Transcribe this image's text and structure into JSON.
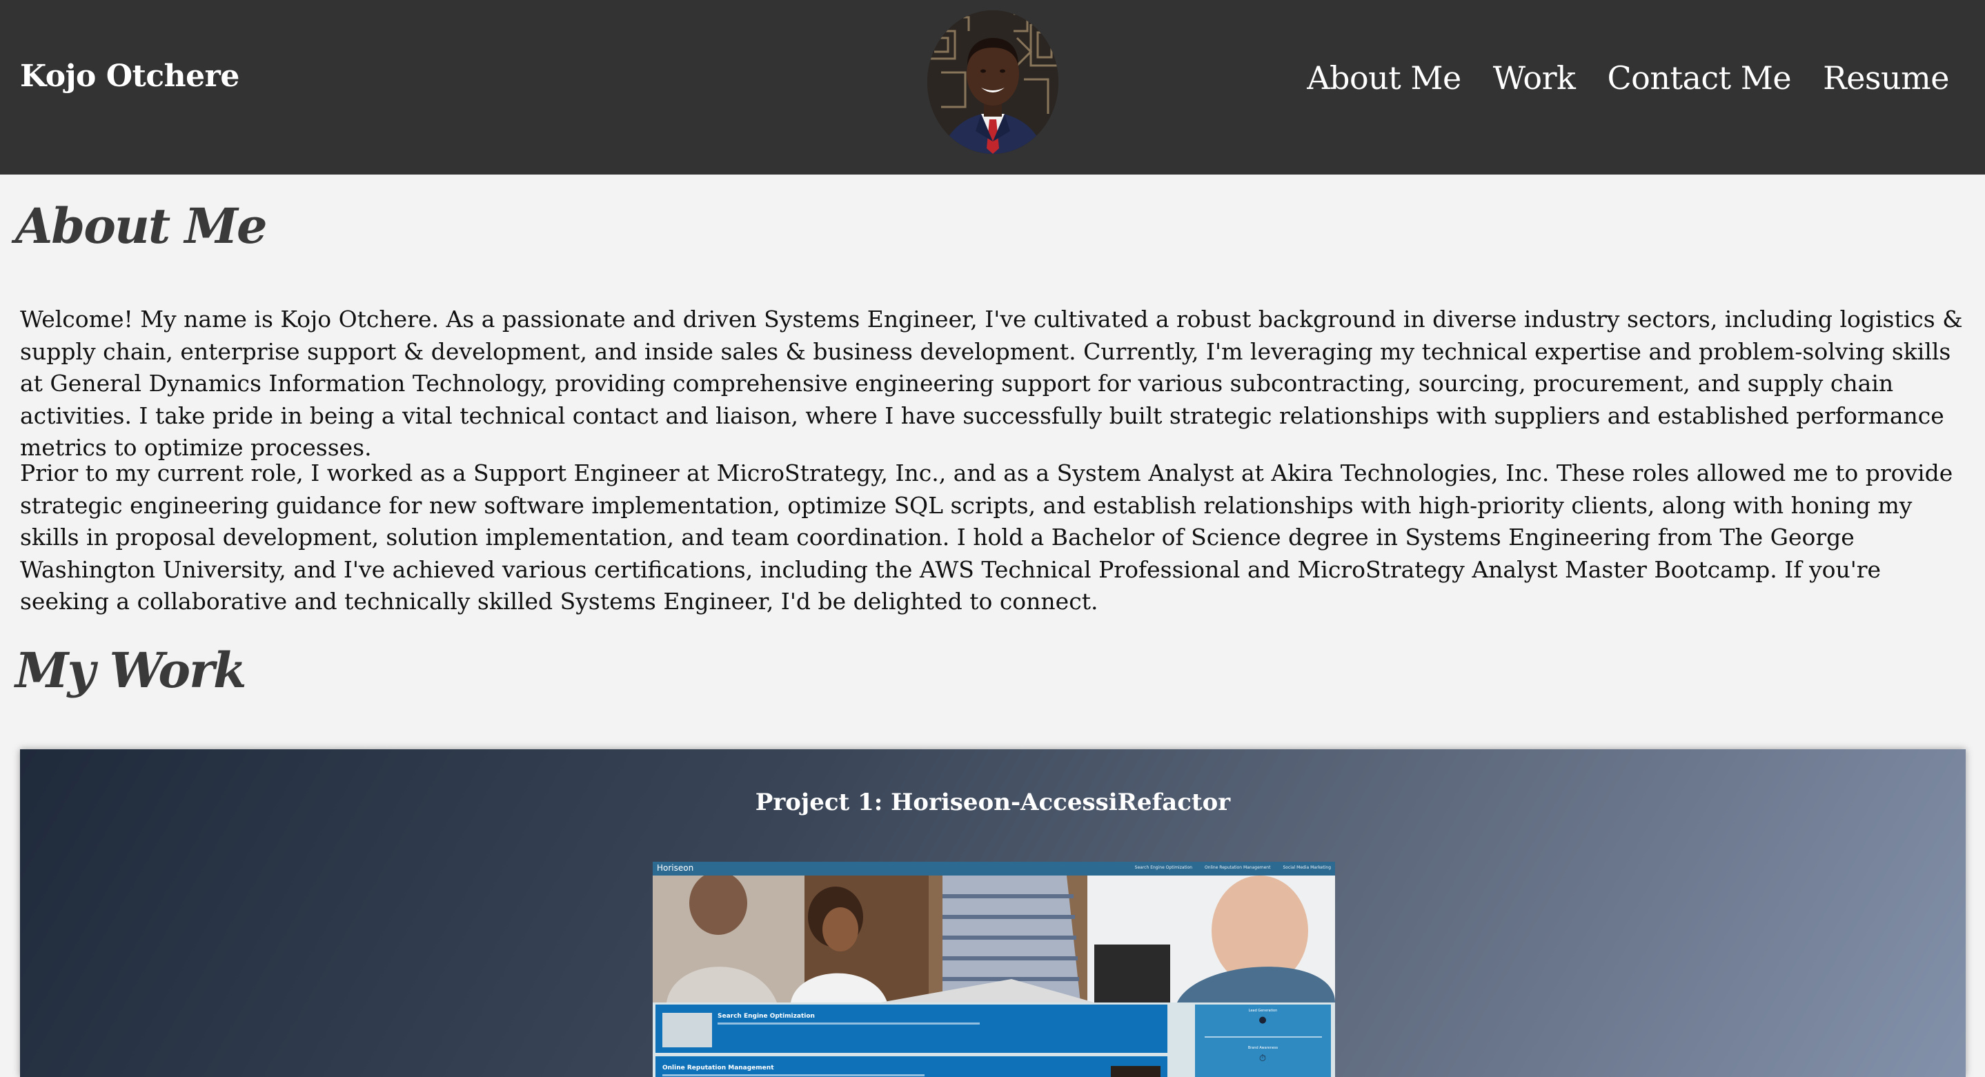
{
  "header": {
    "brand": "Kojo Otchere",
    "nav": [
      {
        "label": "About Me"
      },
      {
        "label": "Work"
      },
      {
        "label": "Contact Me"
      },
      {
        "label": "Resume"
      }
    ]
  },
  "about": {
    "heading": "About Me",
    "paragraphs": [
      "Welcome! My name is Kojo Otchere. As a passionate and driven Systems Engineer, I've cultivated a robust background in diverse industry sectors, including logistics & supply chain, enterprise support & development, and inside sales & business development. Currently, I'm leveraging my technical expertise and problem-solving skills at General Dynamics Information Technology, providing comprehensive engineering support for various subcontracting, sourcing, procurement, and supply chain activities. I take pride in being a vital technical contact and liaison, where I have successfully built strategic relationships with suppliers and established performance metrics to optimize processes.",
      "Prior to my current role, I worked as a Support Engineer at MicroStrategy, Inc., and as a System Analyst at Akira Technologies, Inc. These roles allowed me to provide strategic engineering guidance for new software implementation, optimize SQL scripts, and establish relationships with high-priority clients, along with honing my skills in proposal development, solution implementation, and team coordination. I hold a Bachelor of Science degree in Systems Engineering from The George Washington University, and I've achieved various certifications, including the AWS Technical Professional and MicroStrategy Analyst Master Bootcamp. If you're seeking a collaborative and technically skilled Systems Engineer, I'd be delighted to connect."
    ]
  },
  "work": {
    "heading": "My Work",
    "projects": [
      {
        "title": "Project 1: Horiseon-AccessiRefactor",
        "screenshot": {
          "logo": "Horiseon",
          "nav_links": [
            "Search Engine Optimization",
            "Online Reputation Management",
            "Social Media Marketing"
          ],
          "blocks": [
            "Search Engine Optimization",
            "Online Reputation Management"
          ],
          "sidebar_headings": [
            "Lead Generation",
            "Brand Awareness"
          ]
        }
      }
    ]
  },
  "colors": {
    "header_bg": "#333333",
    "page_bg": "#f3f3f3",
    "heading_text": "#3a3a3a",
    "card_gradient_start": "#1f2a3b",
    "card_gradient_end": "#8391aa"
  },
  "icons": {
    "avatar": "profile-photo",
    "sidebar_icon_1": "lock-icon",
    "sidebar_icon_2": "timer-icon"
  }
}
